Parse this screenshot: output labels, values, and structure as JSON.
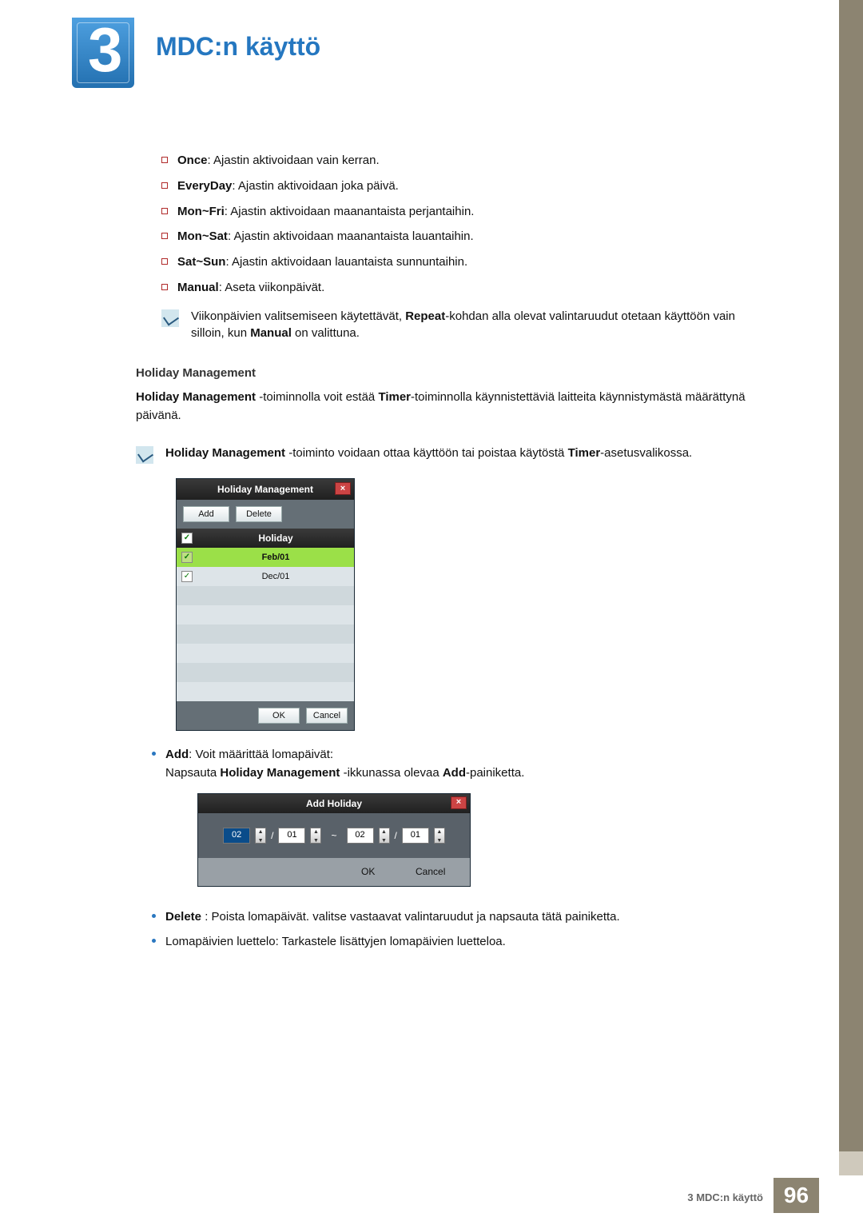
{
  "chapter": {
    "number": "3",
    "title": "MDC:n käyttö"
  },
  "options": {
    "once": {
      "label": "Once",
      "desc": ": Ajastin aktivoidaan vain kerran."
    },
    "everyday": {
      "label": "EveryDay",
      "desc": ": Ajastin aktivoidaan joka päivä."
    },
    "monfri": {
      "label": "Mon~Fri",
      "desc": ": Ajastin aktivoidaan maanantaista perjantaihin."
    },
    "monsat": {
      "label": "Mon~Sat",
      "desc": ": Ajastin aktivoidaan maanantaista lauantaihin."
    },
    "satsun": {
      "label": "Sat~Sun",
      "desc": ": Ajastin aktivoidaan lauantaista sunnuntaihin."
    },
    "manual": {
      "label": "Manual",
      "desc": ": Aseta viikonpäivät."
    }
  },
  "note1": {
    "pre": "Viikonpäivien valitsemiseen käytettävät, ",
    "b1": "Repeat",
    "mid": "-kohdan alla olevat valintaruudut otetaan käyttöön vain silloin, kun ",
    "b2": "Manual",
    "post": " on valittuna."
  },
  "section": {
    "heading": "Holiday Management",
    "para_pre": "Holiday Management",
    "para_mid": " -toiminnolla voit estää ",
    "para_b2": "Timer",
    "para_post": "-toiminnolla käynnistettäviä laitteita käynnistymästä määrättynä päivänä."
  },
  "note2": {
    "b1": "Holiday Management",
    "mid": " -toiminto voidaan ottaa käyttöön tai poistaa käytöstä ",
    "b2": "Timer",
    "post": "-asetusvalikossa."
  },
  "dialog1": {
    "title": "Holiday Management",
    "add": "Add",
    "delete": "Delete",
    "col_holiday": "Holiday",
    "row1": "Feb/01",
    "row2": "Dec/01",
    "ok": "OK",
    "cancel": "Cancel",
    "check": "✓"
  },
  "bullets": {
    "add": {
      "label": "Add",
      "desc": ": Voit määrittää lomapäivät:",
      "line2_pre": "Napsauta ",
      "line2_b1": "Holiday Management",
      "line2_mid": " -ikkunassa olevaa ",
      "line2_b2": "Add",
      "line2_post": "-painiketta."
    },
    "delete": {
      "label": "Delete",
      "desc": " : Poista lomapäivät. valitse vastaavat valintaruudut ja napsauta tätä painiketta."
    },
    "list": {
      "text": "Lomapäivien luettelo: Tarkastele lisättyjen lomapäivien luetteloa."
    }
  },
  "dialog2": {
    "title": "Add Holiday",
    "m1": "02",
    "d1": "01",
    "sep": "~",
    "m2": "02",
    "d2": "01",
    "ok": "OK",
    "cancel": "Cancel",
    "slash": "/"
  },
  "footer": {
    "label": "3 MDC:n käyttö",
    "page": "96"
  }
}
